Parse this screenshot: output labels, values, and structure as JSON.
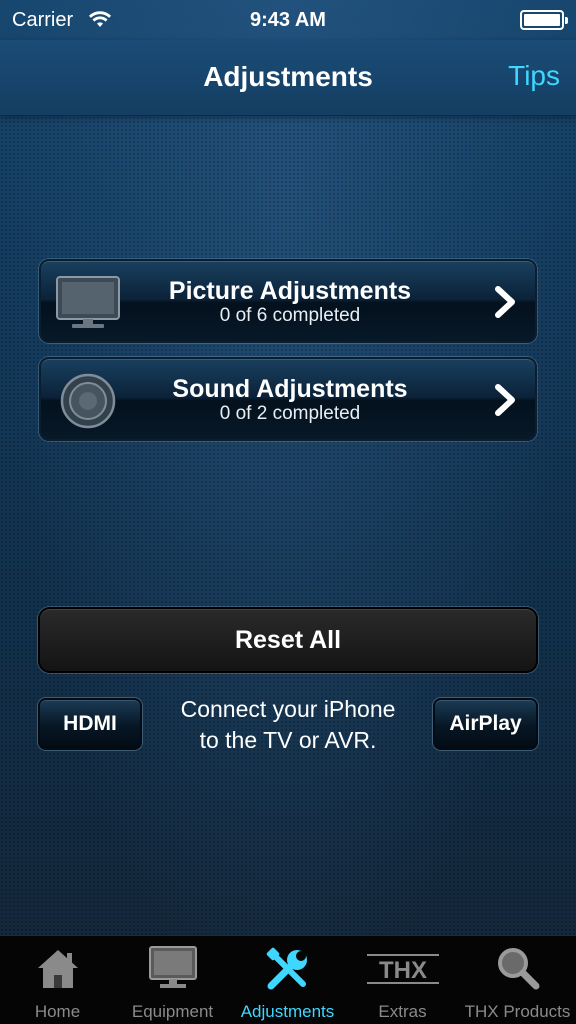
{
  "status_bar": {
    "carrier": "Carrier",
    "time": "9:43 AM",
    "wifi_icon": "wifi-icon",
    "battery_level": 1.0
  },
  "nav": {
    "title": "Adjustments",
    "tips_label": "Tips"
  },
  "adjustments": [
    {
      "title": "Picture Adjustments",
      "subtitle": "0 of 6 completed",
      "icon": "tv-icon"
    },
    {
      "title": "Sound Adjustments",
      "subtitle": "0 of 2 completed",
      "icon": "speaker-icon"
    }
  ],
  "reset_label": "Reset All",
  "hdmi_label": "HDMI",
  "airplay_label": "AirPlay",
  "connect_text": {
    "line1": "Connect your iPhone",
    "line2": "to the TV or AVR."
  },
  "tabs": [
    {
      "label": "Home",
      "icon": "home-icon"
    },
    {
      "label": "Equipment",
      "icon": "tv-icon"
    },
    {
      "label": "Adjustments",
      "icon": "tools-icon",
      "active": true
    },
    {
      "label": "Extras",
      "icon": "thx-logo-icon",
      "logo_text": "THX"
    },
    {
      "label": "THX Products",
      "icon": "magnifier-icon"
    }
  ],
  "colors": {
    "accent": "#3fd6ff",
    "tab_inactive": "#8a8a8a",
    "background": "#133a5c"
  }
}
